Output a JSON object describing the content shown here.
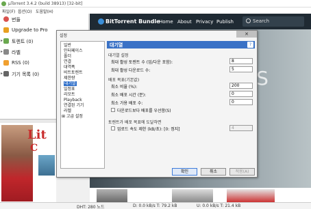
{
  "window": {
    "title": "µTorrent 3.4.2  (build 38913) [32-bit]"
  },
  "menu": [
    "파일(F)",
    "옵션(O)",
    "도움말(H)"
  ],
  "sidebar": {
    "items": [
      {
        "label": "번들",
        "icon": "bundle-icon",
        "color": "#d9534f"
      },
      {
        "label": "Upgrade to Pro",
        "icon": "upgrade-icon",
        "color": "#e8a020"
      },
      {
        "label": "토렌트 (0)",
        "icon": "torrents-icon",
        "color": "#6aa84f"
      },
      {
        "label": "라벨",
        "icon": "labels-icon",
        "color": "#888888"
      },
      {
        "label": "RSS (0)",
        "icon": "rss-icon",
        "color": "#f0a030"
      },
      {
        "label": "기기 목록 (0)",
        "icon": "devices-icon",
        "color": "#666666"
      }
    ]
  },
  "ad": {
    "headline": "Lit",
    "line2": "C"
  },
  "bundle": {
    "logo": "BitTorrent Bundle",
    "nav": [
      "Home",
      "About",
      "Privacy",
      "Publish"
    ],
    "search_placeholder": "Search",
    "hero_text": "TS"
  },
  "dialog": {
    "title": "설정",
    "close": "✕",
    "categories": [
      {
        "label": "일반",
        "sub": false
      },
      {
        "label": "인터페이스",
        "sub": false
      },
      {
        "label": "폴더",
        "sub": false
      },
      {
        "label": "연결",
        "sub": false
      },
      {
        "label": "대역폭",
        "sub": false
      },
      {
        "label": "비트토렌트",
        "sub": false
      },
      {
        "label": "제한량",
        "sub": false
      },
      {
        "label": "대기열",
        "sub": false,
        "selected": true
      },
      {
        "label": "일정표",
        "sub": false
      },
      {
        "label": "리모트",
        "sub": false
      },
      {
        "label": "Playback",
        "sub": false
      },
      {
        "label": "연결된 기기",
        "sub": false
      },
      {
        "label": "라벨",
        "sub": false
      },
      {
        "label": "⊞ 고급 설정",
        "sub": false
      }
    ],
    "panel": {
      "header": "대기열",
      "help": "?",
      "sec1": "대기열 설정",
      "max_active_label": "최대 활성 토렌트 수 (업/다운 포함):",
      "max_active_value": "8",
      "max_down_label": "최대 활성 다운로드 수:",
      "max_down_value": "5",
      "sec2": "배포 목표(기본값)",
      "ratio_label": "최소 비율 (%):",
      "ratio_value": "200",
      "seed_time_label": "최소 배포 시간 (분):",
      "seed_time_value": "0",
      "avail_label": "최소 가용 배포 수:",
      "avail_value": "0",
      "prefer_label": "다운로드보다 배포를 우선함(S)",
      "sec3": "토렌트가 배포 목표에 도달하면",
      "limit_label": "업로드 속도 제한 (kB/초): [0: 정지]",
      "limit_value": "4"
    },
    "buttons": {
      "ok": "확인",
      "cancel": "취소",
      "apply": "적용(A)"
    }
  },
  "status": {
    "dht": "DHT: 280 노드",
    "down": "D: 0.0 kB/s T: 79.2 kB",
    "up": "U: 0.0 kB/s T: 21.4 kB"
  }
}
